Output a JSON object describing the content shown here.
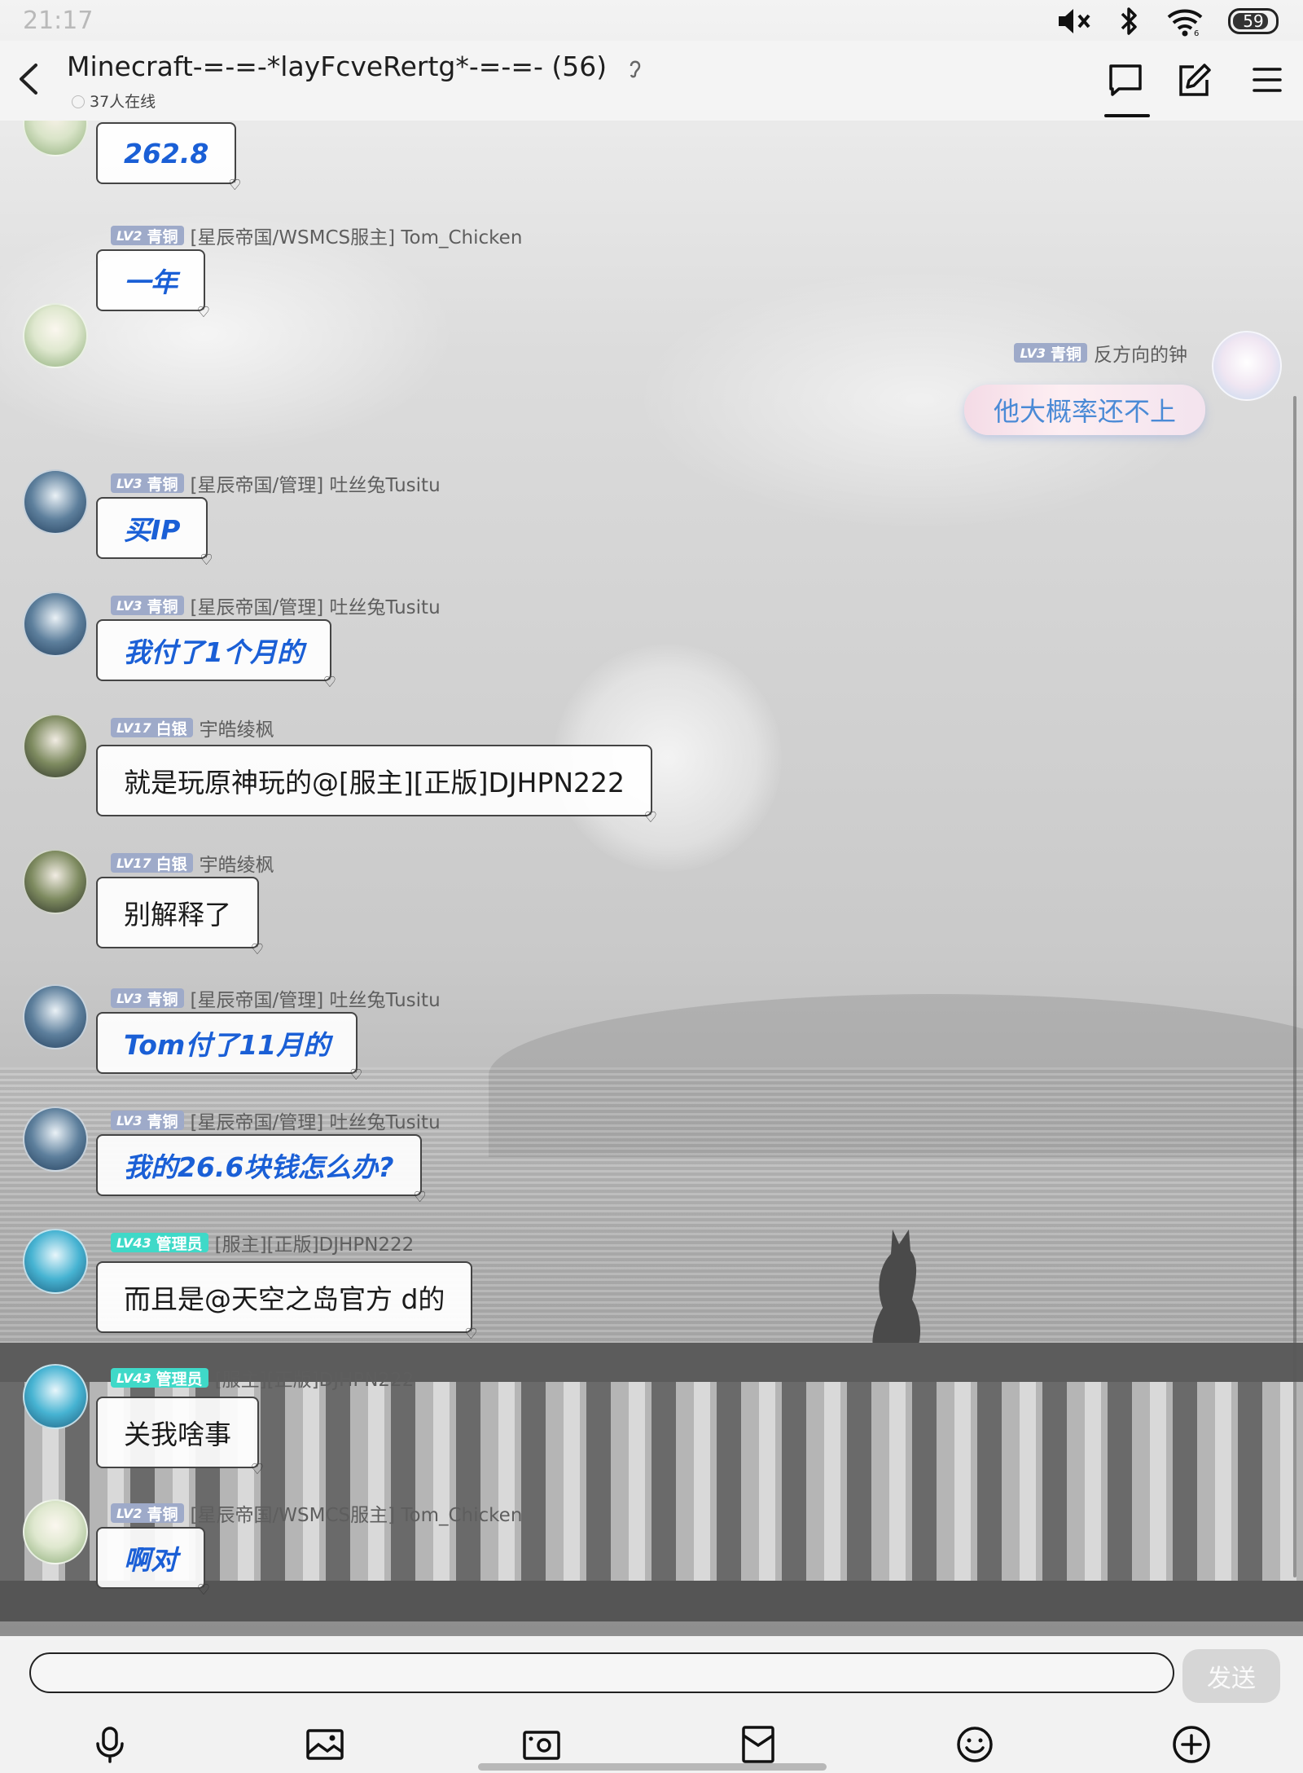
{
  "status_bar": {
    "time": "21:17",
    "battery": "59"
  },
  "header": {
    "title": "Minecraft-=-=-*layFcveRertg*-=-=- (56)",
    "online": "37人在线"
  },
  "messages": [
    {
      "text": "262.8"
    },
    {
      "level": "LV2",
      "rank": "青铜",
      "sender": "[星辰帝国/WSMCS服主] Tom_Chicken",
      "text": "一年"
    },
    {
      "level": "LV3",
      "rank": "青铜",
      "sender": "反方向的钟",
      "text": "他大概率还不上"
    },
    {
      "level": "LV3",
      "rank": "青铜",
      "sender": "[星辰帝国/管理] 吐丝兔Tusitu",
      "text": "买IP"
    },
    {
      "level": "LV3",
      "rank": "青铜",
      "sender": "[星辰帝国/管理] 吐丝兔Tusitu",
      "text": "我付了1个月的"
    },
    {
      "level": "LV17",
      "rank": "白银",
      "sender": "宇皓绫枫",
      "text": "就是玩原神玩的@[服主][正版]DJHPN222"
    },
    {
      "level": "LV17",
      "rank": "白银",
      "sender": "宇皓绫枫",
      "text": "别解释了"
    },
    {
      "level": "LV3",
      "rank": "青铜",
      "sender": "[星辰帝国/管理] 吐丝兔Tusitu",
      "text": "Tom付了11月的"
    },
    {
      "level": "LV3",
      "rank": "青铜",
      "sender": "[星辰帝国/管理] 吐丝兔Tusitu",
      "text": "我的26.6块钱怎么办?"
    },
    {
      "level": "LV43",
      "rank": "管理员",
      "sender": "[服主][正版]DJHPN222",
      "text": "而且是@天空之岛官方 d的"
    },
    {
      "level": "LV43",
      "rank": "管理员",
      "sender": "[服主][正版]DJHPN222",
      "text": "关我啥事"
    },
    {
      "level": "LV2",
      "rank": "青铜",
      "sender": "[星辰帝国/WSMCS服主] Tom_Chicken",
      "text": "啊对"
    }
  ],
  "input": {
    "placeholder": "",
    "send_label": "发送"
  },
  "icons": [
    "back-icon",
    "chat-icon",
    "edit-icon",
    "menu-icon",
    "mic-icon",
    "image-icon",
    "camera-icon",
    "redpacket-icon",
    "emoji-icon",
    "plus-icon"
  ],
  "colors": {
    "accent_blue": "#1a5fd6",
    "badge_bronze": "#9eaac9",
    "badge_admin": "#3fd9c8"
  }
}
